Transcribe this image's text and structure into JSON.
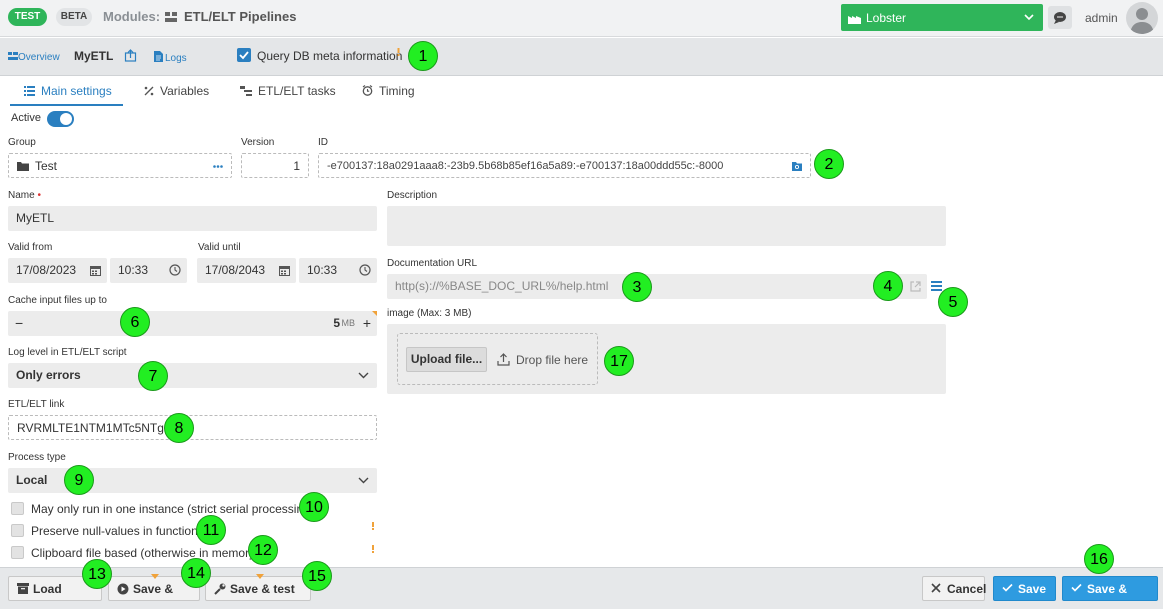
{
  "topbar": {
    "badge_test": "TEST",
    "badge_beta": "BETA",
    "modules_label": "Modules:",
    "module_name": "ETL/ELT Pipelines",
    "tenant": "Lobster",
    "user": "admin"
  },
  "breadcrumb": {
    "overview": "Overview",
    "name": "MyETL",
    "logs": "Logs",
    "meta_label": "Query DB meta information",
    "meta_checked": true
  },
  "tabs": {
    "main": "Main settings",
    "variables": "Variables",
    "tasks": "ETL/ELT tasks",
    "timing": "Timing"
  },
  "form": {
    "active_label": "Active",
    "group_label": "Group",
    "group_value": "Test",
    "version_label": "Version",
    "version_value": "1",
    "id_label": "ID",
    "id_value": "-e700137:18a0291aaa8:-23b9.5b68b85ef16a5a89:-e700137:18a00ddd55c:-8000",
    "name_label": "Name",
    "name_required": "•",
    "name_value": "MyETL",
    "valid_from_label": "Valid from",
    "valid_from_date": "17/08/2023",
    "valid_from_time": "10:33",
    "valid_until_label": "Valid until",
    "valid_until_date": "17/08/2043",
    "valid_until_time": "10:33",
    "cache_label": "Cache input files up to",
    "cache_minus": "−",
    "cache_value": "5",
    "cache_unit": "MB",
    "cache_plus": "+",
    "log_level_label": "Log level in ETL/ELT script",
    "log_level_value": "Only errors",
    "link_label": "ETL/ELT link",
    "link_value": "RVRMLTE1NTM1MTc5NTg",
    "process_label": "Process type",
    "process_value": "Local",
    "chk_serial": "May only run in one instance (strict serial processing)",
    "chk_null": "Preserve null-values in functions",
    "chk_clipboard": "Clipboard file based (otherwise in memory)",
    "description_label": "Description",
    "doc_url_label": "Documentation URL",
    "doc_url_placeholder": "http(s)://%BASE_DOC_URL%/help.html",
    "image_label": "image (Max: 3 MB)",
    "upload_button": "Upload file...",
    "drop_label": "Drop file here"
  },
  "footer": {
    "load_backup": "Load backup",
    "save_start": "Save & start",
    "save_test": "Save & test run",
    "cancel": "Cancel",
    "save": "Save",
    "save_close": "Save & close"
  },
  "callouts": [
    "1",
    "2",
    "3",
    "4",
    "5",
    "6",
    "7",
    "8",
    "9",
    "10",
    "11",
    "12",
    "13",
    "14",
    "15",
    "16",
    "17"
  ],
  "colors": {
    "accent": "#2a7fc0",
    "tenant": "#2fb55a",
    "callout": "#22ee22",
    "primary_button": "#2e9be0"
  }
}
